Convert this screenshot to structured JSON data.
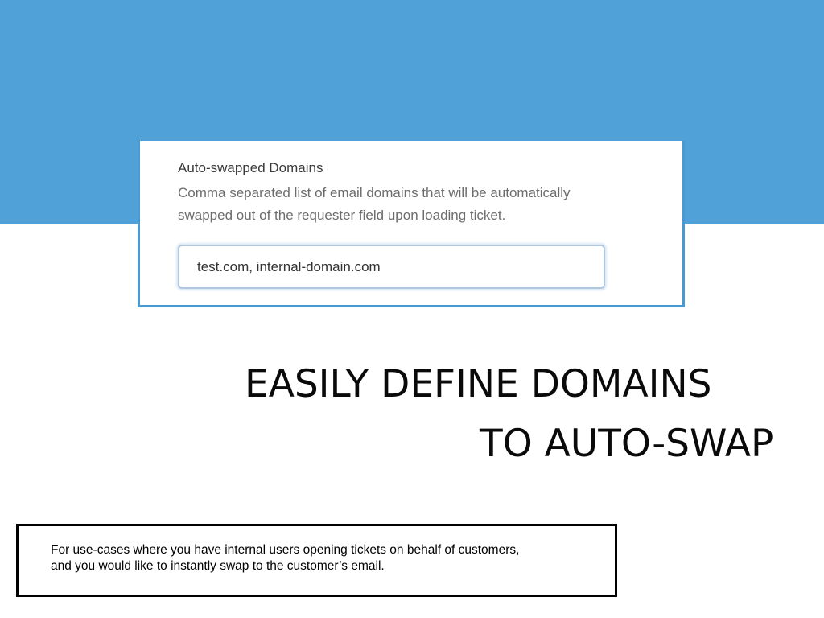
{
  "settings": {
    "field_label": "Auto-swapped Domains",
    "field_help": "Comma separated list of email domains that will be automatically swapped out of the requester field upon loading ticket.",
    "domains_value": "test.com, internal-domain.com"
  },
  "headline": {
    "line1": "EASILY DEFINE DOMAINS",
    "line2": "TO AUTO-SWAP"
  },
  "info": {
    "line1": "For use-cases where you have internal users opening tickets on behalf of customers,",
    "line2": "and you would like to instantly swap to the customer’s email."
  },
  "colors": {
    "banner": "#51a1d9",
    "card_border": "#4a9ad2",
    "headline_text": "#0a0a0a"
  }
}
